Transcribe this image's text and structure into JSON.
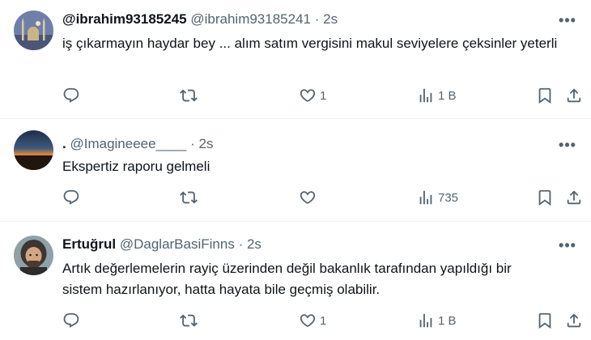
{
  "tweets": [
    {
      "name": "@ibrahim93185245",
      "handle": "@ibrahim93185241",
      "dot": "·",
      "time": "2s",
      "text": "iş çıkarmayın haydar bey ... alım satım vergisini makul seviyelere çeksinler yeterli",
      "likes": "1",
      "views": "1 B",
      "more": "•••",
      "avatar": "mosque-avatar"
    },
    {
      "name": ".",
      "handle": "@Imagineeee____",
      "dot": "·",
      "time": "2s",
      "text": "Ekspertiz raporu gelmeli",
      "likes": "",
      "views": "735",
      "more": "•••",
      "avatar": "sunset-avatar"
    },
    {
      "name": "Ertuğrul",
      "handle": "@DaglarBasiFinns",
      "dot": "·",
      "time": "2s",
      "text": "Artık değerlemelerin rayiç üzerinden değil bakanlık tarafından yapıldığı bir sistem hazırlanıyor, hatta hayata bile geçmiş olabilir.",
      "likes": "1",
      "views": "1 B",
      "more": "•••",
      "avatar": "person-avatar"
    }
  ],
  "icons": [
    "reply-icon",
    "retweet-icon",
    "like-icon",
    "views-icon",
    "bookmark-icon",
    "share-icon"
  ],
  "colors": {
    "text": "#0f1419",
    "secondary": "#536471",
    "divider": "#eff3f4"
  }
}
